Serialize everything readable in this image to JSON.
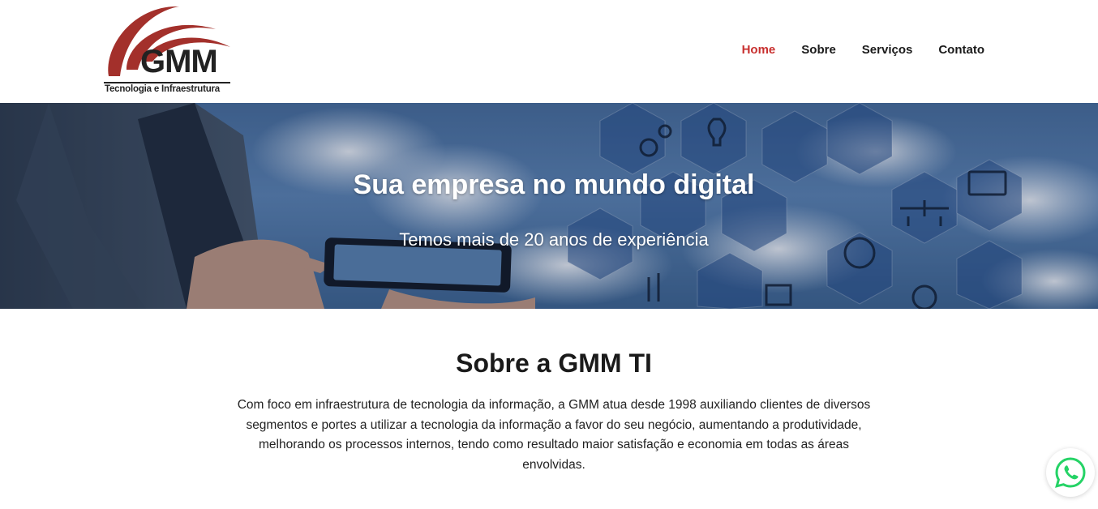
{
  "header": {
    "logo_text": "GMM",
    "logo_tagline": "Tecnologia e Infraestrutura",
    "nav": [
      {
        "label": "Home",
        "active": true
      },
      {
        "label": "Sobre",
        "active": false
      },
      {
        "label": "Serviços",
        "active": false
      },
      {
        "label": "Contato",
        "active": false
      }
    ]
  },
  "hero": {
    "title": "Sua empresa no mundo digital",
    "subtitle": "Temos mais de 20 anos de experiência"
  },
  "about": {
    "title": "Sobre a GMM TI",
    "text": "Com foco em infraestrutura de tecnologia da informação, a GMM atua desde 1998 auxiliando clientes de diversos segmentos e portes a utilizar a tecnologia da informação a favor do seu negócio, aumentando a produtividade, melhorando os processos internos, tendo como resultado maior satisfação e economia em todas as áreas envolvidas."
  },
  "colors": {
    "brand_red": "#a3302b",
    "nav_active": "#c8302f",
    "whatsapp_green": "#25d366"
  },
  "icons": {
    "whatsapp": "whatsapp-icon"
  }
}
